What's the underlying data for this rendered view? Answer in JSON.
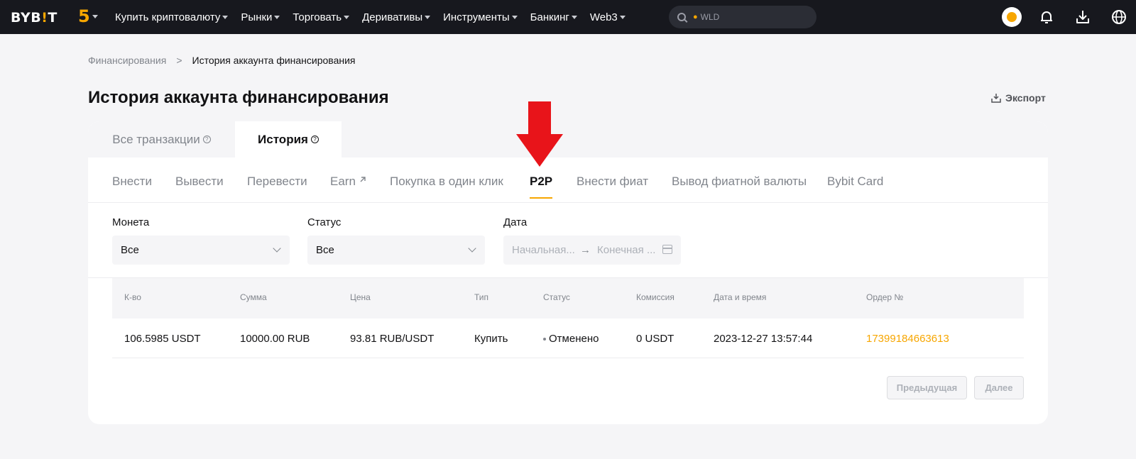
{
  "header": {
    "logo_text": "BYB",
    "logo_bang": "!",
    "logo_end": "T",
    "five": "5",
    "nav": [
      "Купить криптовалюту",
      "Рынки",
      "Торговать",
      "Деривативы",
      "Инструменты",
      "Банкинг",
      "Web3"
    ],
    "search_value": "WLD"
  },
  "breadcrumb": {
    "root": "Финансирования",
    "separator": ">",
    "current": "История аккаунта финансирования"
  },
  "page": {
    "title": "История аккаунта финансирования",
    "export_label": "Экспорт"
  },
  "main_tabs": [
    {
      "label": "Все транзакции",
      "active": false
    },
    {
      "label": "История",
      "active": true
    }
  ],
  "sub_tabs": [
    {
      "label": "Внести",
      "active": false
    },
    {
      "label": "Вывести",
      "active": false
    },
    {
      "label": "Перевести",
      "active": false
    },
    {
      "label": "Earn",
      "active": false
    },
    {
      "label": "Покупка в один клик",
      "active": false
    },
    {
      "label": "P2P",
      "active": true
    },
    {
      "label": "Внести фиат",
      "active": false
    },
    {
      "label": "Вывод фиатной валюты",
      "active": false
    },
    {
      "label": "Bybit Card",
      "active": false
    }
  ],
  "filters": {
    "coin": {
      "label": "Монета",
      "value": "Все"
    },
    "status": {
      "label": "Статус",
      "value": "Все"
    },
    "date": {
      "label": "Дата",
      "start_placeholder": "Начальная...",
      "end_placeholder": "Конечная ...",
      "arrow": "→"
    }
  },
  "table": {
    "headers": [
      "К-во",
      "Сумма",
      "Цена",
      "Тип",
      "Статус",
      "Комиссия",
      "Дата и время",
      "Ордер №"
    ],
    "rows": [
      [
        "106.5985 USDT",
        "10000.00 RUB",
        "93.81 RUB/USDT",
        "Купить",
        "Отменено",
        "0 USDT",
        "2023-12-27 13:57:44",
        "17399184663613"
      ]
    ]
  },
  "pagination": {
    "prev": "Предыдущая",
    "next": "Далее"
  },
  "colors": {
    "accent": "#f7a600",
    "topbar": "#17181e",
    "annotation": "#e8141a"
  },
  "icons": [
    "search-icon",
    "flame-icon",
    "avatar",
    "bell-icon",
    "download-icon",
    "globe-icon",
    "export-icon",
    "help-icon",
    "external-link-icon",
    "chevron-down-icon",
    "calendar-icon",
    "red-arrow-annotation"
  ]
}
